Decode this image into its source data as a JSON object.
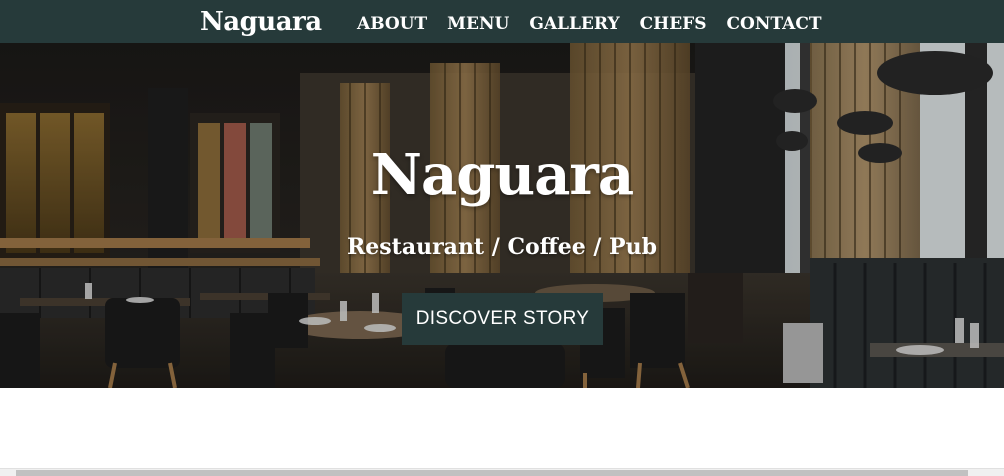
{
  "navbar": {
    "brand": "Naguara",
    "links": [
      "ABOUT",
      "MENU",
      "GALLERY",
      "CHEFS",
      "CONTACT"
    ],
    "background_color": "#263a3a"
  },
  "hero": {
    "title": "Naguara",
    "subtitle": "Restaurant / Coffee / Pub",
    "cta_label": "DISCOVER STORY",
    "image": "restaurant-interior-photo"
  }
}
